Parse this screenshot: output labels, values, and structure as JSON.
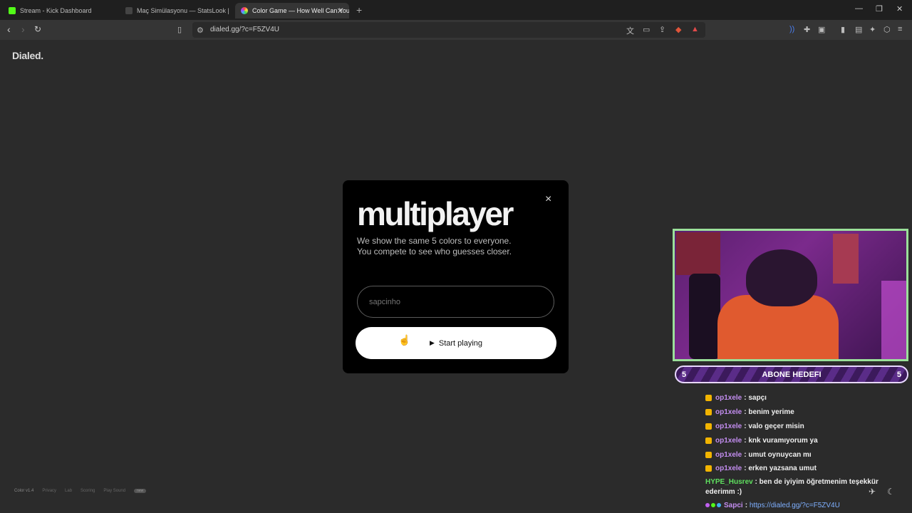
{
  "browser": {
    "tabs": [
      {
        "title": "Stream - Kick Dashboard",
        "favicon_color": "#53fc18"
      },
      {
        "title": "Maç Simülasyonu — StatsLook | Stats",
        "favicon_color": "#444444"
      },
      {
        "title": "Color Game — How Well Can You",
        "favicon_color": "#e05aa0"
      }
    ],
    "new_tab": "+",
    "url": "dialed.gg/?c=F5ZV4U"
  },
  "page": {
    "logo": "Dialed."
  },
  "modal": {
    "title": "multiplayer",
    "subtitle_line1": "We show the same 5 colors to everyone.",
    "subtitle_line2": "You compete to see who guesses closer.",
    "name_placeholder": "sapcinho",
    "start_label": "Start playing",
    "close": "×"
  },
  "footer": {
    "version": "Color v1.4",
    "links": [
      "Privacy",
      "Lab",
      "Scoring",
      "Play Sound"
    ],
    "badge": "new"
  },
  "overlay": {
    "goal_left": "5",
    "goal_title": "ABONE HEDEFI",
    "goal_right": "5",
    "chat": [
      {
        "user": "op1xele",
        "text": ": sapçı"
      },
      {
        "user": "op1xele",
        "text": ": benim yerime"
      },
      {
        "user": "op1xele",
        "text": ": valo geçer misin"
      },
      {
        "user": "op1xele",
        "text": ": knk vuramıyorum ya"
      },
      {
        "user": "op1xele",
        "text": ": umut oynuycan mı"
      },
      {
        "user": "op1xele",
        "text": ": erken yazsana umut"
      }
    ],
    "hype_user": "HYPE_Husrev",
    "hype_text": ": ben de iyiyim öğretmenim teşekkür ederimm :)",
    "last_user": "Sapci",
    "last_sep": ":",
    "last_link": "https://dialed.gg/?c=F5ZV4U"
  }
}
